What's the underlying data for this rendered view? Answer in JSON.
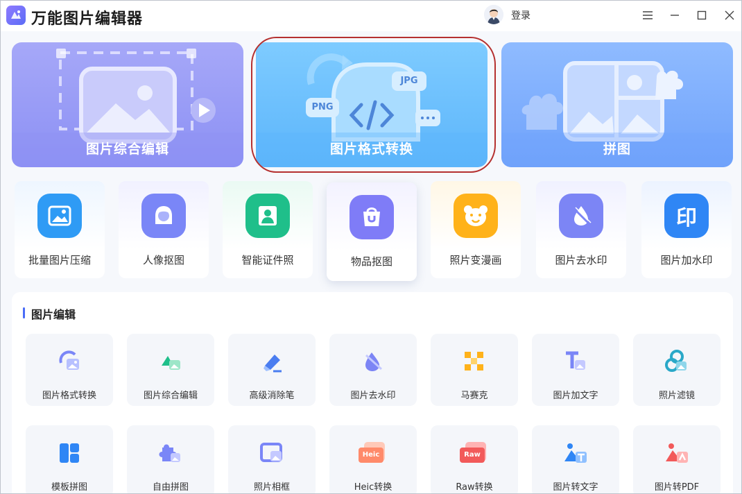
{
  "app": {
    "title": "万能图片编辑器"
  },
  "header": {
    "login_label": "登录"
  },
  "hero_cards": [
    {
      "label": "图片综合编辑"
    },
    {
      "label": "图片格式转换",
      "badge_png": "PNG",
      "badge_jpg": "JPG"
    },
    {
      "label": "拼图"
    }
  ],
  "quick_tools": [
    {
      "label": "批量图片压缩",
      "icon": "image-icon",
      "color": "#2f9bf5"
    },
    {
      "label": "人像抠图",
      "icon": "portrait-icon",
      "color": "#7a86f7"
    },
    {
      "label": "智能证件照",
      "icon": "id-photo-icon",
      "color": "#1fbf8a"
    },
    {
      "label": "物品抠图",
      "icon": "bag-icon",
      "color": "#7f7cf7"
    },
    {
      "label": "照片变漫画",
      "icon": "cartoon-bear-icon",
      "color": "#ffb21a"
    },
    {
      "label": "图片去水印",
      "icon": "drop-erase-icon",
      "color": "#7c85f5"
    },
    {
      "label": "图片加水印",
      "icon": "stamp-icon",
      "color": "#2f86f5",
      "glyph": "印"
    }
  ],
  "section": {
    "title": "图片编辑"
  },
  "edit_tools_row1": [
    {
      "label": "图片格式转换",
      "icon": "format-convert-icon"
    },
    {
      "label": "图片综合编辑",
      "icon": "image-edit-icon"
    },
    {
      "label": "高级消除笔",
      "icon": "eraser-pen-icon"
    },
    {
      "label": "图片去水印",
      "icon": "watermark-remove-icon"
    },
    {
      "label": "马赛克",
      "icon": "mosaic-icon"
    },
    {
      "label": "图片加文字",
      "icon": "add-text-icon"
    },
    {
      "label": "照片滤镜",
      "icon": "filter-icon"
    }
  ],
  "edit_tools_row2": [
    {
      "label": "模板拼图",
      "icon": "template-collage-icon"
    },
    {
      "label": "自由拼图",
      "icon": "free-collage-icon"
    },
    {
      "label": "照片相框",
      "icon": "photo-frame-icon"
    },
    {
      "label": "Heic转换",
      "icon": "heic-icon",
      "badge": "Heic"
    },
    {
      "label": "Raw转换",
      "icon": "raw-icon",
      "badge": "Raw"
    },
    {
      "label": "图片转文字",
      "icon": "image-to-text-icon"
    },
    {
      "label": "图片转PDF",
      "icon": "image-to-pdf-icon"
    }
  ]
}
